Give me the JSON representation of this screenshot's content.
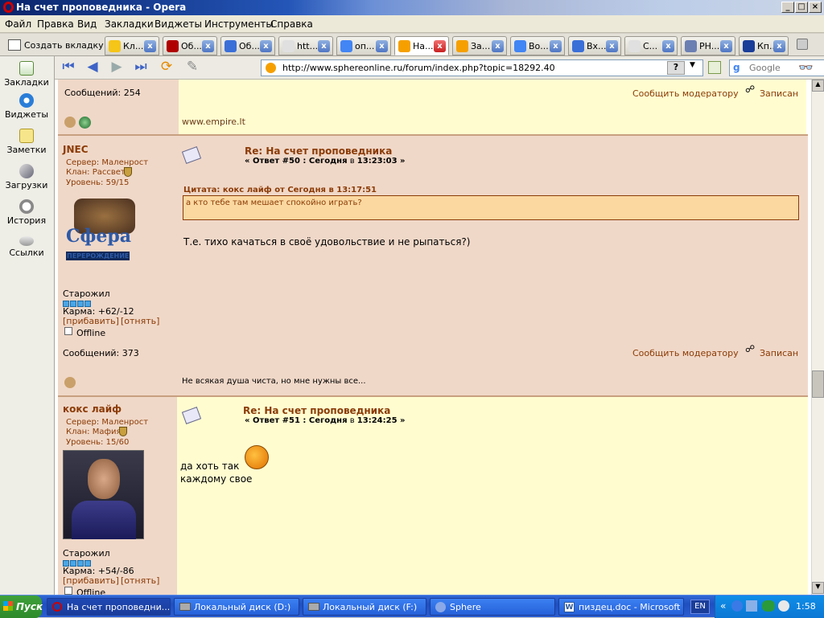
{
  "window": {
    "title": "На счет проповедника - Opera"
  },
  "menu": [
    "Файл",
    "Правка",
    "Вид",
    "Закладки",
    "Виджеты",
    "Инструменты",
    "Справка"
  ],
  "tabs": {
    "new_tab_label": "Создать вкладку",
    "items": [
      {
        "label": "Кл...",
        "icon": "smiley-icon",
        "color": "#f5c518"
      },
      {
        "label": "Об...",
        "icon": "m-logo-icon",
        "color": "#b00000"
      },
      {
        "label": "Об...",
        "icon": "ds-icon",
        "color": "#3a6fd8"
      },
      {
        "label": "htt...",
        "icon": "page-icon",
        "color": "#e0e0e0"
      },
      {
        "label": "оп...",
        "icon": "google-icon",
        "color": "#4285f4"
      },
      {
        "label": "На...",
        "icon": "forum-icon",
        "color": "#f5a000",
        "active": true
      },
      {
        "label": "За...",
        "icon": "forum-icon",
        "color": "#f5a000"
      },
      {
        "label": "Во...",
        "icon": "google-icon",
        "color": "#4285f4"
      },
      {
        "label": "Вх...",
        "icon": "mail-icon",
        "color": "#3a6fd8"
      },
      {
        "label": "С...",
        "icon": "page-icon",
        "color": "#e0e0e0"
      },
      {
        "label": "PH...",
        "icon": "php-icon",
        "color": "#6b7fb3"
      },
      {
        "label": "Кп...",
        "icon": "grad-icon",
        "color": "#1a3d99"
      }
    ]
  },
  "sidebar": [
    {
      "label": "Закладки",
      "icon": "bookmark-icon"
    },
    {
      "label": "Виджеты",
      "icon": "widget-icon"
    },
    {
      "label": "Заметки",
      "icon": "notes-icon"
    },
    {
      "label": "Загрузки",
      "icon": "download-icon"
    },
    {
      "label": "История",
      "icon": "history-icon"
    },
    {
      "label": "Ссылки",
      "icon": "links-icon"
    }
  ],
  "address": {
    "url": "http://www.sphereonline.ru/forum/index.php?topic=18292.40",
    "search_placeholder": "Google"
  },
  "forum": {
    "prev_post": {
      "messages": "Сообщений: 254",
      "report": "Сообщить модератору",
      "logged": "Записан",
      "signature": "www.empire.lt"
    },
    "post50": {
      "author": "JNEC",
      "server": "Сервер: Маленрост",
      "clan": "Клан: Рассвет",
      "level": "Уровень: 59/15",
      "avatar_text": "Сфера",
      "avatar_sub": "ПЕРЕРОЖДЕНИЕ",
      "rank": "Старожил",
      "karma": "Карма: +62/-12",
      "karma_add": "[прибавить]",
      "karma_sub": "[отнять]",
      "status": "Offline",
      "messages": "Сообщений: 373",
      "subject": "Re: На счет проповедника",
      "meta_prefix": "« Ответ #50 : Сегодня",
      "meta_mid": " в ",
      "meta_time": "13:23:03 »",
      "quote_header": "Цитата: кокс лайф от Сегодня в 13:17:51",
      "quote": "а кто тебе там мешает спокойно играть?",
      "body": "Т.е. тихо качаться в своё удовольствие и не рыпаться?)",
      "report": "Сообщить модератору",
      "logged": "Записан",
      "signature": "Не всякая душа чиста, но мне нужны все..."
    },
    "post51": {
      "author": "кокс лайф",
      "server": "Сервер: Маленрост",
      "clan": "Клан: Мафия",
      "level": "Уровень: 15/60",
      "rank": "Старожил",
      "karma": "Карма: +54/-86",
      "karma_add": "[прибавить]",
      "karma_sub": "[отнять]",
      "status": "Offline",
      "subject": "Re: На счет проповедника",
      "meta_prefix": "« Ответ #51 : Сегодня",
      "meta_mid": " в ",
      "meta_time": "13:24:25 »",
      "body_line1": "да хоть так",
      "body_line2": "каждому свое"
    }
  },
  "taskbar": {
    "start": "Пуск",
    "tasks": [
      "На счет проповедни...",
      "Локальный диск (D:)",
      "Локальный диск (F:)",
      "Sphere",
      "пиздец.doc - Microsoft ..."
    ],
    "lang": "EN",
    "clock": "1:58"
  }
}
